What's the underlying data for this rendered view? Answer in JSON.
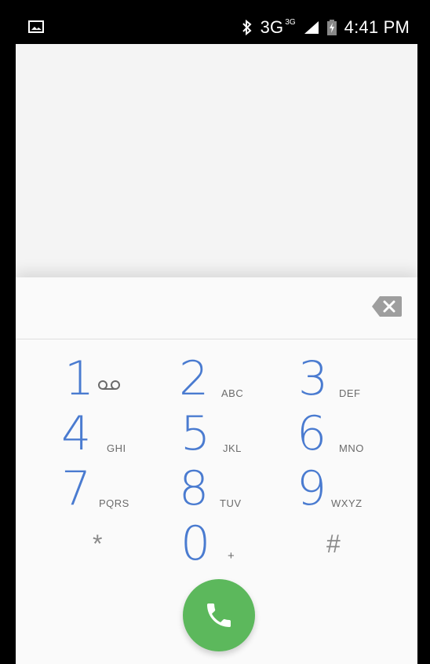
{
  "status_bar": {
    "bluetooth_icon": "bluetooth-icon",
    "network_label": "3G",
    "network_sup": "3G",
    "time": "4:41 PM"
  },
  "dialer": {
    "digits": "",
    "keys": [
      {
        "digit": "1",
        "letters": ""
      },
      {
        "digit": "2",
        "letters": "ABC"
      },
      {
        "digit": "3",
        "letters": "DEF"
      },
      {
        "digit": "4",
        "letters": "GHI"
      },
      {
        "digit": "5",
        "letters": "JKL"
      },
      {
        "digit": "6",
        "letters": "MNO"
      },
      {
        "digit": "7",
        "letters": "PQRS"
      },
      {
        "digit": "8",
        "letters": "TUV"
      },
      {
        "digit": "9",
        "letters": "WXYZ"
      },
      {
        "digit": "*",
        "letters": ""
      },
      {
        "digit": "0",
        "letters": "+"
      },
      {
        "digit": "#",
        "letters": ""
      }
    ]
  },
  "colors": {
    "digit": "#4a7bd0",
    "call_button": "#5cb85c",
    "status_bar": "#000000"
  }
}
